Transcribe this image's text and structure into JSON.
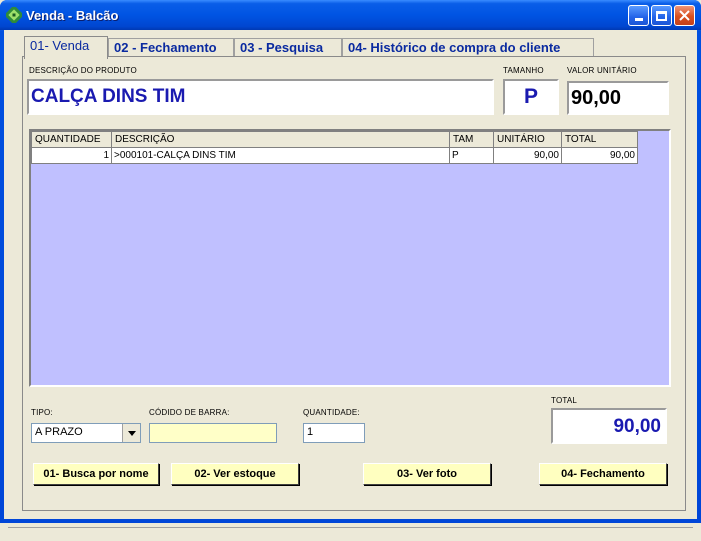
{
  "window": {
    "title": "Venda - Balcão"
  },
  "tabs": [
    {
      "label": "01- Venda"
    },
    {
      "label": "02 - Fechamento"
    },
    {
      "label": "03 - Pesquisa"
    },
    {
      "label": "04- Histórico de compra do cliente"
    }
  ],
  "product": {
    "description_label": "DESCRIÇÃO DO PRODUTO",
    "description_value": "CALÇA DINS  TIM",
    "size_label": "TAMANHO",
    "size_value": "P",
    "unit_price_label": "VALOR UNITÁRIO",
    "unit_price_value": "90,00"
  },
  "grid": {
    "columns": [
      "QUANTIDADE",
      "DESCRIÇÃO",
      "TAM",
      "UNITÁRIO",
      "TOTAL"
    ],
    "rows": [
      {
        "quantidade": "1",
        "descricao": ">000101-CALÇA DINS  TIM",
        "tam": "P",
        "unitario": "90,00",
        "total": "90,00"
      }
    ]
  },
  "footer": {
    "tipo_label": "TIPO:",
    "tipo_value": "A PRAZO",
    "barcode_label": "CÓDIDO DE BARRA:",
    "barcode_value": "",
    "qty_label": "QUANTIDADE:",
    "qty_value": "1",
    "total_label": "TOTAL",
    "total_value": "90,00"
  },
  "buttons": {
    "busca": "01- Busca por nome",
    "estoque": "02- Ver estoque",
    "foto": "03- Ver foto",
    "fechamento": "04- Fechamento"
  },
  "colors": {
    "accent_text": "#1a1ab0",
    "grid_background": "#c0c0ff",
    "button_background": "#ffffc0",
    "barcode_background": "#ffffc8"
  }
}
